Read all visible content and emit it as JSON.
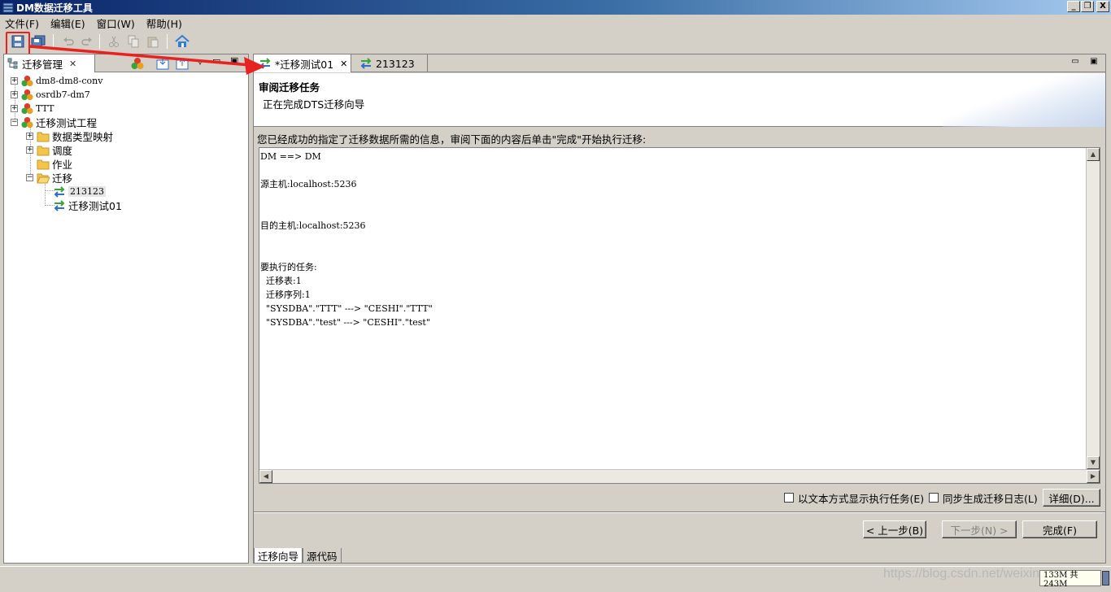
{
  "window": {
    "title": "DM数据迁移工具",
    "buttons": [
      "_",
      "❐",
      "X"
    ]
  },
  "menu": [
    "文件(F)",
    "编辑(E)",
    "窗口(W)",
    "帮助(H)"
  ],
  "toolbar": {
    "icons": [
      "save-icon",
      "save-all-icon",
      "undo-icon",
      "redo-icon",
      "cut-icon",
      "copy-icon",
      "paste-icon",
      "home-icon"
    ]
  },
  "left_panel": {
    "tab_label": "迁移管理",
    "tree": [
      {
        "label": "dm8-dm8-conv"
      },
      {
        "label": "osrdb7-dm7"
      },
      {
        "label": "TTT"
      },
      {
        "label": "迁移测试工程"
      },
      {
        "label": "数据类型映射"
      },
      {
        "label": "调度"
      },
      {
        "label": "作业"
      },
      {
        "label": "迁移"
      },
      {
        "label": "213123"
      },
      {
        "label": "迁移测试01"
      }
    ]
  },
  "editor": {
    "tabs": [
      {
        "label": "*迁移测试01"
      },
      {
        "label": "213123"
      }
    ],
    "header_title": "审阅迁移任务",
    "header_subtitle": "正在完成DTS迁移向导",
    "instruction": "您已经成功的指定了迁移数据所需的信息，审阅下面的内容后单击\"完成\"开始执行迁移:",
    "content_lines": [
      "DM ==> DM",
      "",
      "源主机:localhost:5236",
      "",
      "",
      "目的主机:localhost:5236",
      "",
      "",
      "要执行的任务:",
      "  迁移表:1",
      "  迁移序列:1",
      "  \"SYSDBA\".\"TTT\" ---> \"CESHI\".\"TTT\"",
      "  \"SYSDBA\".\"test\" ---> \"CESHI\".\"test\""
    ],
    "option_text_mode": "以文本方式显示执行任务(E)",
    "option_sync_log": "同步生成迁移日志(L)",
    "details_button": "详细(D)...",
    "prev_button": "< 上一步(B)",
    "next_button": "下一步(N) >",
    "finish_button": "完成(F)",
    "bottom_tabs": [
      "迁移向导",
      "源代码"
    ]
  },
  "status": {
    "memory": "133M 共 243M",
    "watermark": "https://blog.csdn.net/weixin"
  },
  "colors": {
    "annotation_red": "#e8231f",
    "title_blue": "#0a246a"
  }
}
